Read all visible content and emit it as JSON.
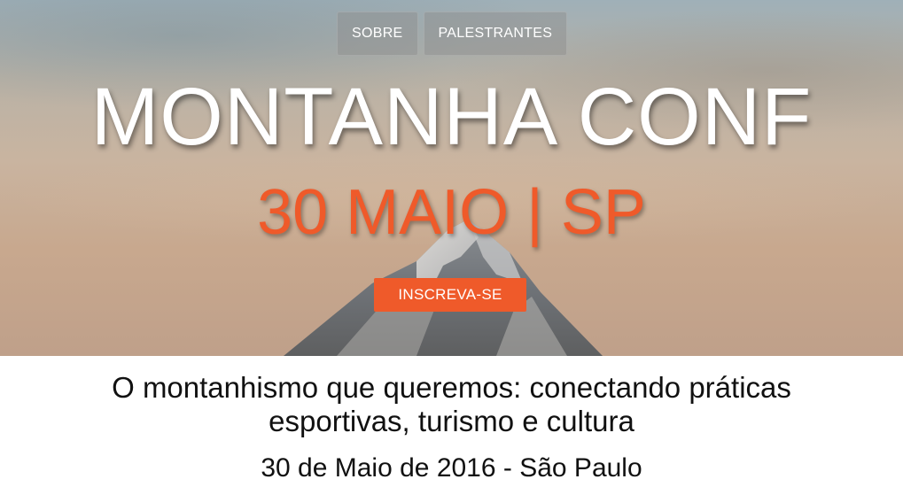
{
  "nav": {
    "items": [
      {
        "label": "SOBRE"
      },
      {
        "label": "PALESTRANTES"
      }
    ]
  },
  "hero": {
    "title": "MONTANHA CONF",
    "date_line": "30 MAIO | SP",
    "cta_label": "INSCREVA-SE",
    "background_image": "mountain-peak-photo"
  },
  "content": {
    "subtitle_line1": "O montanhismo que queremos: conectando práticas",
    "subtitle_line2": "esportivas, turismo e cultura",
    "event_date": "30 de Maio de 2016 - São Paulo"
  },
  "colors": {
    "accent": "#ef5a2a",
    "title_text": "#ffffff",
    "body_text": "#111111"
  }
}
